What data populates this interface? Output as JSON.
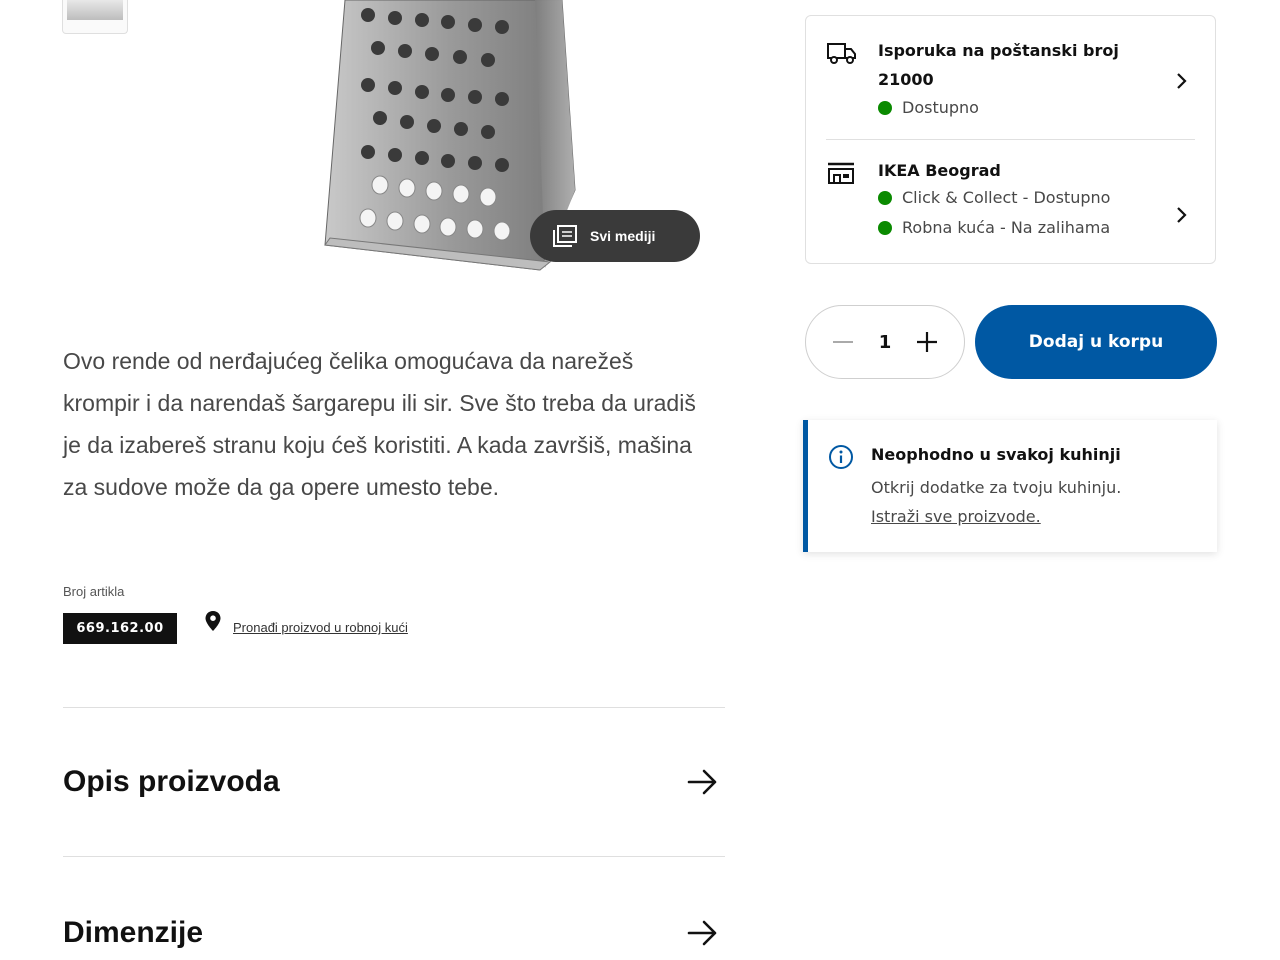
{
  "product": {
    "description": "Ovo rende od nerđajućeg čelika omogućava da narežeš krompir i da narendaš šargarepu ili sir. Sve što treba da uradiš je da izabereš stranu koju ćeš koristiti. A kada završiš, mašina za sudove može da ga opere umesto tebe.",
    "media_button_label": "Svi mediji",
    "article_label": "Broj artikla",
    "article_number": "669.162.00",
    "find_in_store_link": "Pronađi proizvod u robnoj kući"
  },
  "accordions": [
    {
      "title": "Opis proizvoda"
    },
    {
      "title": "Dimenzije"
    }
  ],
  "availability": {
    "delivery": {
      "title_line1": "Isporuka na poštanski broj",
      "title_line2": "21000",
      "status": "Dostupno"
    },
    "store": {
      "title": "IKEA Beograd",
      "status_click_collect": "Click & Collect - Dostupno",
      "status_store": "Robna kuća - Na zalihama"
    }
  },
  "purchase": {
    "quantity": "1",
    "add_to_cart_label": "Dodaj u korpu"
  },
  "info_card": {
    "title": "Neophodno u svakoj kuhinji",
    "text": "Otkrij dodatke za tvoju kuhinju.",
    "link": "Istraži sve proizvode."
  },
  "colors": {
    "brand_blue": "#0058a3",
    "available_green": "#0a8a00",
    "text_dark": "#111111",
    "text_muted": "#484848"
  },
  "icons": [
    "truck-icon",
    "store-icon",
    "chevron-right-icon",
    "images-icon",
    "map-pin-icon",
    "minus-icon",
    "plus-icon",
    "info-icon",
    "arrow-right-icon"
  ]
}
